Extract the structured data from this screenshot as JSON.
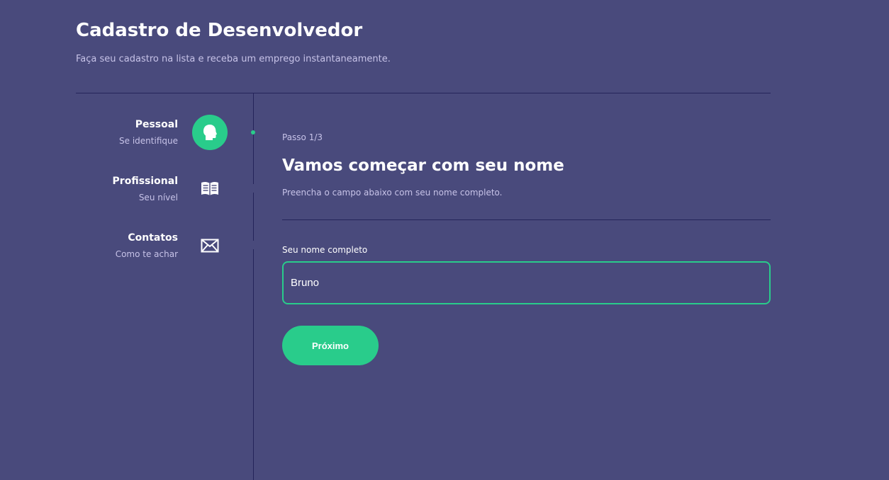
{
  "header": {
    "title": "Cadastro de Desenvolvedor",
    "subtitle": "Faça seu cadastro na lista e receba um emprego instantaneamente."
  },
  "steps": [
    {
      "title": "Pessoal",
      "subtitle": "Se identifique",
      "icon": "user-head-icon",
      "active": true
    },
    {
      "title": "Profissional",
      "subtitle": "Seu nível",
      "icon": "book-icon",
      "active": false
    },
    {
      "title": "Contatos",
      "subtitle": "Como te achar",
      "icon": "mail-icon",
      "active": false
    }
  ],
  "content": {
    "step_label": "Passo 1/3",
    "heading": "Vamos começar com seu nome",
    "description": "Preencha o campo abaixo com seu nome completo.",
    "field_label": "Seu nome completo",
    "field_value": "Bruno",
    "next_label": "Próximo"
  },
  "colors": {
    "background": "#494a7c",
    "accent": "#29cc8b",
    "divider": "#24245a",
    "muted_text": "#c7c3e8"
  }
}
